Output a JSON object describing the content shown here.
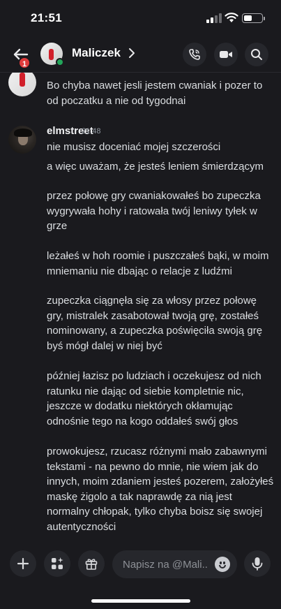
{
  "status_bar": {
    "time": "21:51"
  },
  "header": {
    "back_badge": "1",
    "title": "Maliczek",
    "call_icon": "phone-icon",
    "video_icon": "video-camera-icon",
    "search_icon": "search-icon"
  },
  "messages": {
    "previous_continuation": "Bo chyba nawet jesli jestem cwaniak i pozer to od poczatku a nie od tygodnai",
    "author": "elmstreet",
    "timestamp": "21:48",
    "items": [
      "nie musisz doceniać mojej szczerości",
      "a więc uważam, że jesteś leniem śmierdzącym",
      "przez połowę gry cwaniakowałeś bo zupeczka wygrywała hohy i ratowała twój leniwy tyłek w grze",
      "leżałeś w hoh roomie i puszczałeś bąki, w moim mniemaniu nie dbając o relacje z ludźmi",
      "zupeczka ciągnęła się za włosy przez połowę gry, mistralek zasabotował twoją grę, zostałeś nominowany, a zupeczka poświęciła swoją grę byś mógł dalej w niej być",
      "później łazisz po ludziach i oczekujesz od nich ratunku nie dając od siebie kompletnie nic, jeszcze w dodatku niektórych okłamując odnośnie tego na kogo oddałeś swój głos",
      "prowokujesz, rzucasz różnymi mało zabawnymi tekstami - na pewno do mnie, nie wiem jak do innych, moim zdaniem jesteś pozerem, założyłeś maskę żigolo a tak naprawdę za nią jest normalny chłopak, tylko chyba boisz się swojej autentyczności"
    ]
  },
  "composer": {
    "placeholder": "Napisz na @Mali..",
    "plus_icon": "plus-icon",
    "apps_icon": "apps-sparkle-icon",
    "gift_icon": "gift-icon",
    "emoji_icon": "emoji-icon",
    "mic_icon": "microphone-icon"
  }
}
